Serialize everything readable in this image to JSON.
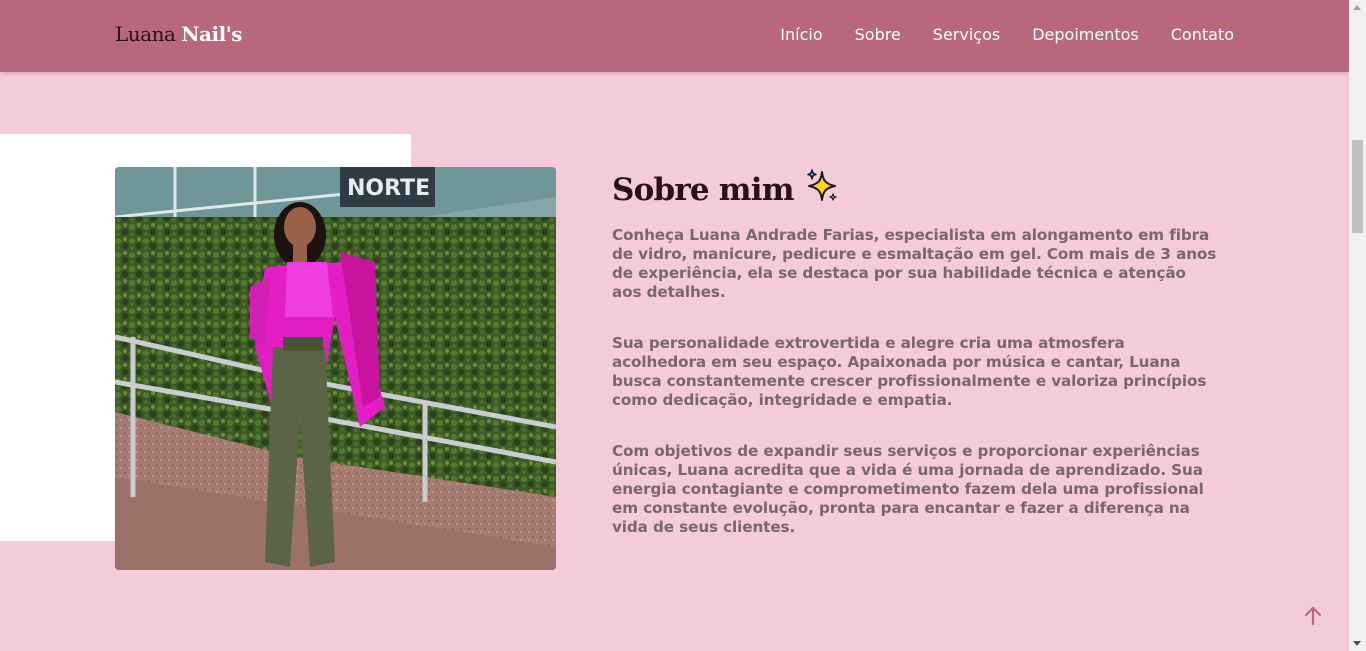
{
  "brand": {
    "part1": "Luana",
    "part2": "Nail's"
  },
  "nav": [
    {
      "label": "Início"
    },
    {
      "label": "Sobre"
    },
    {
      "label": "Serviços"
    },
    {
      "label": "Depoimentos"
    },
    {
      "label": "Contato"
    }
  ],
  "about": {
    "title": "Sobre mim",
    "title_icon": "sparkles-icon",
    "paragraphs": [
      "Conheça Luana Andrade Farias, especialista em alongamento em fibra de vidro, manicure, pedicure e esmaltação em gel. Com mais de 3 anos de experiência, ela se destaca por sua habilidade técnica e atenção aos detalhes.",
      "Sua personalidade extrovertida e alegre cria uma atmosfera acolhedora em seu espaço. Apaixonada por música e cantar, Luana busca constantemente crescer profissionalmente e valoriza princípios como dedicação, integridade e empatia.",
      "Com objetivos de expandir seus serviços e proporcionar experiências únicas, Luana acredita que a vida é uma jornada de aprendizado. Sua energia contagiante e comprometimento fazem dela uma profissional em constante evolução, pronta para encantar e fazer a diferença na vida de seus clientes."
    ]
  },
  "icons": {
    "back_to_top": "arrow-up-icon"
  },
  "colors": {
    "header_bg": "#b9677e",
    "page_bg": "#f4cbd8",
    "title": "#2a1018",
    "body_text": "#7a6670",
    "accent": "#b9677e"
  }
}
